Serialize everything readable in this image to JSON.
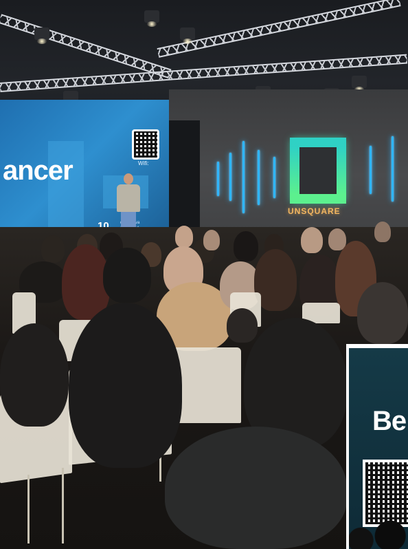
{
  "screen_left": {
    "title": "ancer",
    "wifi_label": "Wifi:",
    "bottom_number": "10",
    "bottom_small": "de reserva publicidad"
  },
  "wall": {
    "brand": "UNSQUARE"
  },
  "inset": {
    "text": "Be"
  },
  "colors": {
    "screen_blue": "#2e8fcf",
    "neon_blue": "#2fb6ff",
    "logo_green": "#3fe0b0",
    "logo_text": "#f3b660"
  }
}
